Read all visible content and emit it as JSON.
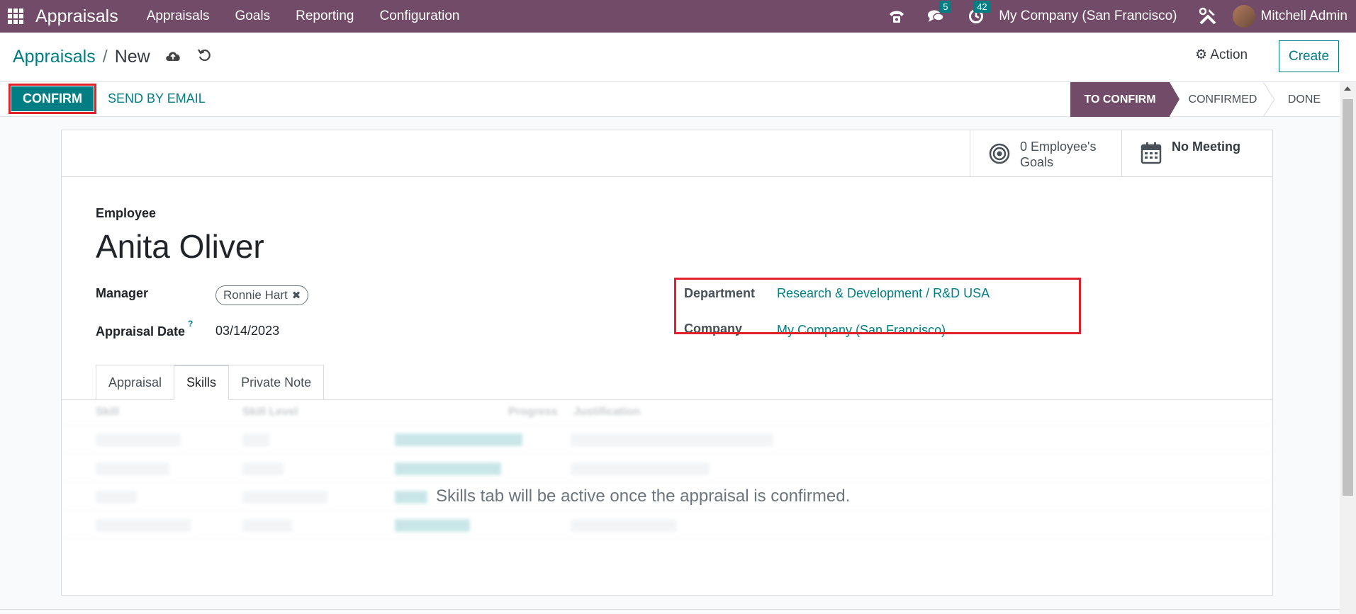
{
  "topnav": {
    "app_name": "Appraisals",
    "menu": [
      "Appraisals",
      "Goals",
      "Reporting",
      "Configuration"
    ],
    "messages_count": "5",
    "activities_count": "42",
    "company": "My Company (San Francisco)",
    "user": "Mitchell Admin",
    "color": "#714b67"
  },
  "control": {
    "breadcrumb_parent": "Appraisals",
    "breadcrumb_sep": "/",
    "breadcrumb_current": "New",
    "action_label": "Action",
    "create_label": "Create"
  },
  "statusbar": {
    "confirm_label": "CONFIRM",
    "email_label": "SEND BY EMAIL",
    "stages": [
      "TO CONFIRM",
      "CONFIRMED",
      "DONE"
    ],
    "active_stage": "TO CONFIRM"
  },
  "smart_buttons": {
    "goals_line1": "0 Employee's",
    "goals_line2": "Goals",
    "meeting_label": "No Meeting"
  },
  "form": {
    "employee_label": "Employee",
    "employee_name": "Anita Oliver",
    "manager_label": "Manager",
    "manager_value": "Ronnie Hart",
    "appraisal_date_label": "Appraisal Date",
    "appraisal_date_help": "?",
    "appraisal_date_value": "03/14/2023",
    "department_label": "Department",
    "department_value": "Research & Development / R&D USA",
    "company_label": "Company",
    "company_value": "My Company (San Francisco)"
  },
  "tabs": [
    "Appraisal",
    "Skills",
    "Private Note"
  ],
  "active_tab": "Skills",
  "skills": {
    "columns": [
      "Skill",
      "Skill Level",
      "Progress",
      "Justification"
    ],
    "message": "Skills tab will be active once the appraisal is confirmed."
  },
  "colors": {
    "accent": "#017e84",
    "highlight": "#e0202a"
  }
}
